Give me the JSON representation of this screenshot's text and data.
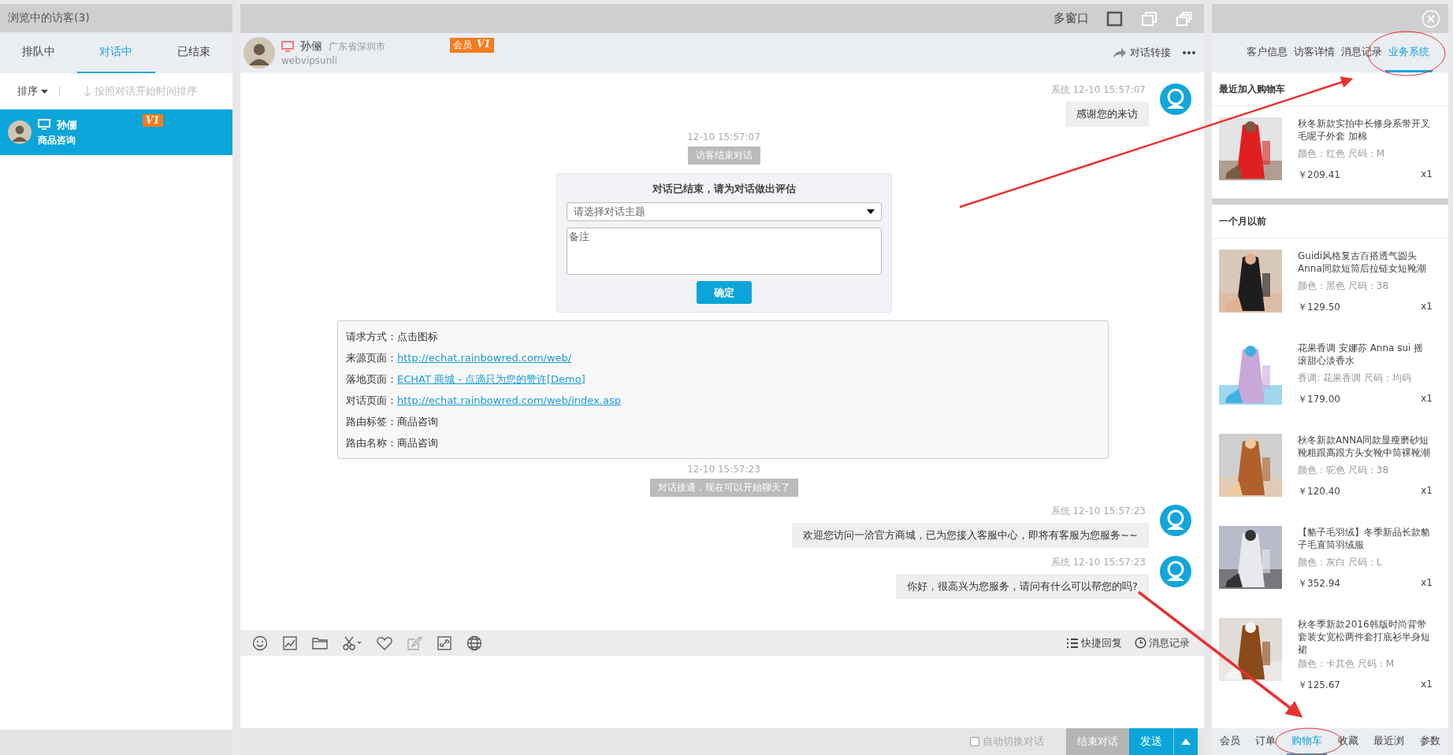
{
  "visitor_panel": {
    "title": "浏览中的访客(3)",
    "tabs": [
      {
        "label": "排队中",
        "selected": false
      },
      {
        "label": "对话中",
        "selected": true
      },
      {
        "label": "已结束",
        "selected": false
      }
    ],
    "sort": {
      "label": "排序",
      "hint": "按照对话开始时间排序"
    },
    "visitors": [
      {
        "name": "孙俪",
        "topic": "商品咨询",
        "badge": "V1",
        "selected": true
      }
    ]
  },
  "chat": {
    "window_label": "多窗口",
    "header": {
      "name": "孙俪",
      "location": "广东省深圳市",
      "account": "webvipsunli",
      "member_badge": "会员",
      "level_badge": "V1",
      "transfer": "对话转接"
    },
    "messages": [
      {
        "kind": "agent",
        "sender": "系统",
        "time": "12-10 15:57:07",
        "text": "感谢您的来访"
      },
      {
        "kind": "notice",
        "time": "12-10 15:57:07",
        "text": "访客结束对话"
      },
      {
        "kind": "evaluation",
        "title": "对话已结束，请为对话做出评估",
        "select_placeholder": "请选择对话主题",
        "note_placeholder": "备注",
        "button": "确定"
      },
      {
        "kind": "info",
        "rows": [
          {
            "label": "请求方式：",
            "value": "点击图标",
            "link": false
          },
          {
            "label": "来源页面：",
            "value": "http://echat.rainbowred.com/web/",
            "link": true
          },
          {
            "label": "落地页面：",
            "value": "ECHAT 商城 - 点滴只为您的赞许[Demo]",
            "link": true
          },
          {
            "label": "对话页面：",
            "value": "http://echat.rainbowred.com/web/index.asp",
            "link": true
          },
          {
            "label": "路由标签：",
            "value": "商品咨询",
            "link": false
          },
          {
            "label": "路由名称：",
            "value": "商品咨询",
            "link": false
          }
        ]
      },
      {
        "kind": "notice",
        "time": "12-10 15:57:23",
        "text": "对话接通，现在可以开始聊天了"
      },
      {
        "kind": "agent",
        "sender": "系统",
        "time": "12-10 15:57:23",
        "text": "欢迎您访问一洽官方商城，已为您接入客服中心，即将有客服为您服务~~"
      },
      {
        "kind": "agent",
        "sender": "系统",
        "time": "12-10 15:57:23",
        "text": "你好，很高兴为您服务，请问有什么可以帮您的吗?"
      }
    ],
    "toolbar": {
      "quick_reply": "快捷回复",
      "history": "消息记录"
    },
    "footer": {
      "auto_switch": {
        "label": "自动切换对话",
        "checked": false
      },
      "end_button": "结束对话",
      "send_button": "发送"
    }
  },
  "side_panel": {
    "tabs": [
      {
        "label": "客户信息",
        "selected": false
      },
      {
        "label": "访客详情",
        "selected": false
      },
      {
        "label": "消息记录",
        "selected": false
      },
      {
        "label": "业务系统",
        "selected": true
      }
    ],
    "sections": [
      {
        "title": "最近加入购物车",
        "items": [
          {
            "kind": "picture",
            "title": "秋冬新款实拍中长修身系带开叉毛呢子外套 加棉",
            "attrs": "颜色：红色 尺码：M",
            "price": "￥209.41",
            "qty": "x1"
          }
        ]
      },
      {
        "title": "一个月以前",
        "items": [
          {
            "kind": "picture",
            "title": "Guidi风格复古百搭透气圆头Anna同款短筒后拉链女短靴潮",
            "attrs": "颜色：黑色 尺码：38",
            "price": "￥129.50",
            "qty": "x1"
          },
          {
            "kind": "picture",
            "title": "花果香调 安娜苏 Anna sui 摇滚甜心淡香水",
            "attrs": "香调: 花果香调 尺码：均码",
            "price": "￥179.00",
            "qty": "x1"
          },
          {
            "kind": "picture",
            "title": "秋冬新款ANNA同款显瘦磨砂短靴粗跟高跟方头女靴中筒裸靴潮",
            "attrs": "颜色：驼色 尺码：38",
            "price": "￥120.40",
            "qty": "x1"
          },
          {
            "kind": "picture",
            "title": "【貉子毛羽绒】冬季新品长款貉子毛直筒羽绒服",
            "attrs": "颜色：灰白 尺码：L",
            "price": "￥352.94",
            "qty": "x1"
          },
          {
            "kind": "picture",
            "title": "秋冬季新款2016韩版时尚背带套装女宽松两件套打底衫半身短裙",
            "attrs": "颜色：卡其色 尺码：M",
            "price": "￥125.67",
            "qty": "x1"
          }
        ]
      }
    ],
    "bottom_tabs": [
      {
        "label": "会员",
        "selected": false
      },
      {
        "label": "订单",
        "selected": false
      },
      {
        "label": "购物车",
        "selected": true
      },
      {
        "label": "收藏",
        "selected": false
      },
      {
        "label": "最近浏",
        "selected": false
      },
      {
        "label": "参数",
        "selected": false
      }
    ]
  }
}
